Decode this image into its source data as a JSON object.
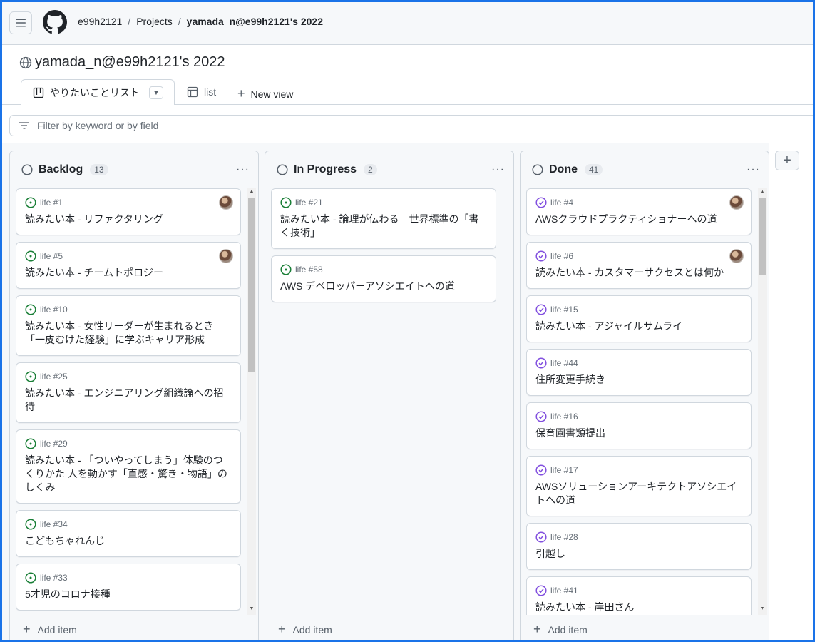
{
  "breadcrumb": {
    "owner": "e99h2121",
    "projects": "Projects",
    "current": "yamada_n@e99h2121's 2022"
  },
  "page": {
    "title": "yamada_n@e99h2121's 2022"
  },
  "tabs": [
    {
      "label": "やりたいことリスト",
      "icon": "board-icon",
      "active": true
    },
    {
      "label": "list",
      "icon": "table-icon",
      "active": false
    }
  ],
  "new_view_label": "New view",
  "filter": {
    "placeholder": "Filter by keyword or by field"
  },
  "add_item_label": "Add item",
  "colors": {
    "open": "#1a7f37",
    "done": "#8250df"
  },
  "columns": [
    {
      "name": "Backlog",
      "count": "13",
      "cards": [
        {
          "ref": "life #1",
          "title": "読みたい本 - リファクタリング",
          "avatar": true
        },
        {
          "ref": "life #5",
          "title": "読みたい本 - チームトポロジー",
          "avatar": true
        },
        {
          "ref": "life #10",
          "title": "読みたい本 - 女性リーダーが生まれるとき「一皮むけた経験」に学ぶキャリア形成",
          "avatar": false
        },
        {
          "ref": "life #25",
          "title": "読みたい本 - エンジニアリング組織論への招待",
          "avatar": false
        },
        {
          "ref": "life #29",
          "title": "読みたい本 - 「ついやってしまう」体験のつくりかた 人を動かす「直感・驚き・物語」のしくみ",
          "avatar": false
        },
        {
          "ref": "life #34",
          "title": "こどもちゃれんじ",
          "avatar": false
        },
        {
          "ref": "life #33",
          "title": "5才児のコロナ接種",
          "avatar": false
        }
      ]
    },
    {
      "name": "In Progress",
      "count": "2",
      "cards": [
        {
          "ref": "life #21",
          "title": "読みたい本 - 論理が伝わる　世界標準の「書く技術」",
          "avatar": false
        },
        {
          "ref": "life #58",
          "title": "AWS デベロッパーアソシエイトへの道",
          "avatar": false
        }
      ]
    },
    {
      "name": "Done",
      "count": "41",
      "cards": [
        {
          "ref": "life #4",
          "title": "AWSクラウドプラクティショナーへの道",
          "avatar": true
        },
        {
          "ref": "life #6",
          "title": "読みたい本 - カスタマーサクセスとは何か",
          "avatar": true
        },
        {
          "ref": "life #15",
          "title": "読みたい本 - アジャイルサムライ",
          "avatar": false
        },
        {
          "ref": "life #44",
          "title": "住所変更手続き",
          "avatar": false
        },
        {
          "ref": "life #16",
          "title": "保育園書類提出",
          "avatar": false
        },
        {
          "ref": "life #17",
          "title": "AWSソリューションアーキテクトアソシエイトへの道",
          "avatar": false
        },
        {
          "ref": "life #28",
          "title": "引越し",
          "avatar": false
        },
        {
          "ref": "life #41",
          "title": "読みたい本 - 岸田さん",
          "avatar": false
        }
      ]
    }
  ]
}
